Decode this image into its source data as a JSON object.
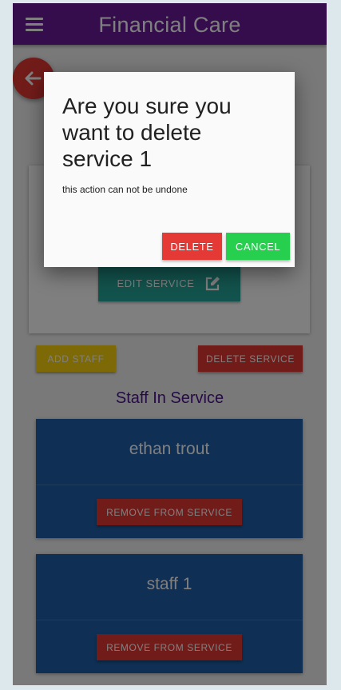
{
  "appbar": {
    "title": "Financial Care"
  },
  "service_card": {
    "edit_label": "EDIT SERVICE"
  },
  "actions": {
    "add_staff_label": "ADD STAFF",
    "delete_service_label": "DELETE SERVICE"
  },
  "staff_section": {
    "title": "Staff In Service",
    "members": [
      {
        "name": "ethan trout",
        "remove_label": "REMOVE FROM SERVICE"
      },
      {
        "name": "staff 1",
        "remove_label": "REMOVE FROM SERVICE"
      }
    ]
  },
  "dialog": {
    "title": "Are you sure you want to delete service 1",
    "message": "this action can not be undone",
    "delete_label": "DELETE",
    "cancel_label": "CANCEL"
  },
  "colors": {
    "appbar": "#6a1b9a",
    "danger": "#e53935",
    "edit": "#26a69a",
    "add_staff": "#fbd30b",
    "staff_card": "#1e5fa8",
    "confirm_cancel": "#26d04e"
  },
  "icons": {
    "menu": "hamburger-menu-icon",
    "back": "arrow-left-icon",
    "edit": "pencil-square-icon"
  }
}
